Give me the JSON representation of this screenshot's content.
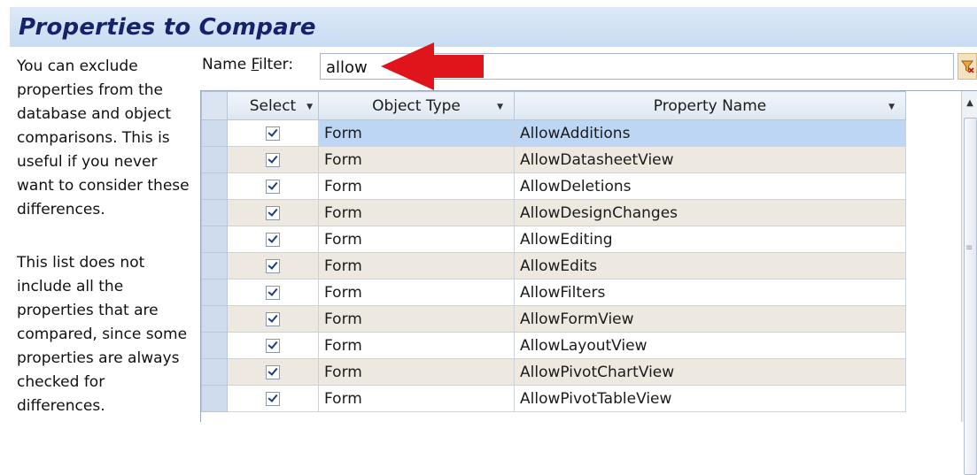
{
  "header": {
    "title": "Properties to Compare"
  },
  "description": {
    "paragraph1": "You can exclude properties from the database and object comparisons. This is useful if you never want to consider these differences.",
    "paragraph2": "This list does not include all the properties that are compared, since some properties are always checked for differences."
  },
  "filter": {
    "label_prefix": "Name ",
    "label_hotkey": "F",
    "label_suffix": "ilter:",
    "value": "allow"
  },
  "grid": {
    "columns": {
      "select": "Select",
      "object_type": "Object Type",
      "property_name": "Property Name"
    },
    "rows": [
      {
        "checked": true,
        "object_type": "Form",
        "property_name": "AllowAdditions"
      },
      {
        "checked": true,
        "object_type": "Form",
        "property_name": "AllowDatasheetView"
      },
      {
        "checked": true,
        "object_type": "Form",
        "property_name": "AllowDeletions"
      },
      {
        "checked": true,
        "object_type": "Form",
        "property_name": "AllowDesignChanges"
      },
      {
        "checked": true,
        "object_type": "Form",
        "property_name": "AllowEditing"
      },
      {
        "checked": true,
        "object_type": "Form",
        "property_name": "AllowEdits"
      },
      {
        "checked": true,
        "object_type": "Form",
        "property_name": "AllowFilters"
      },
      {
        "checked": true,
        "object_type": "Form",
        "property_name": "AllowFormView"
      },
      {
        "checked": true,
        "object_type": "Form",
        "property_name": "AllowLayoutView"
      },
      {
        "checked": true,
        "object_type": "Form",
        "property_name": "AllowPivotChartView"
      },
      {
        "checked": true,
        "object_type": "Form",
        "property_name": "AllowPivotTableView"
      }
    ]
  },
  "colors": {
    "title": "#16236b",
    "arrow": "#e0141b",
    "row_highlight": "#bcd6f3",
    "row_alt": "#ede9e0"
  }
}
